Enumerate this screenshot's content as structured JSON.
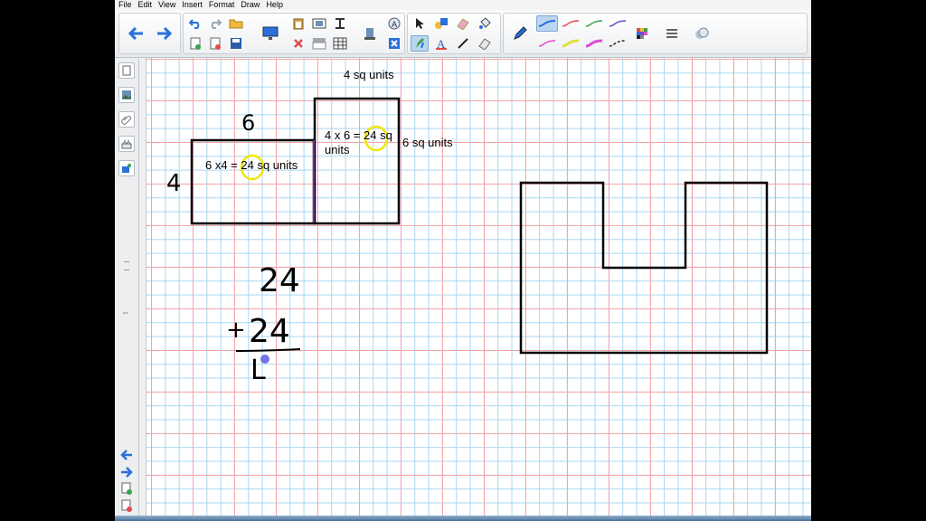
{
  "menu": [
    "File",
    "Edit",
    "View",
    "Insert",
    "Format",
    "Draw",
    "Help"
  ],
  "toolbar_icons": [
    "back-arrow-icon",
    "forward-arrow-icon",
    "undo-icon",
    "redo-icon",
    "open-file-icon",
    "save-icon",
    "screen-shade-icon",
    "delete-icon",
    "insert-table-icon",
    "pen-tool-icon",
    "select-arrow-icon",
    "fill-icon",
    "eraser-icon",
    "line-icon",
    "text-icon",
    "pen-color-icon",
    "color-palette-icon",
    "properties-icon"
  ],
  "pen_colors": [
    "#2a6fdb",
    "#e24b4b",
    "#3aa34a",
    "#6a4fc8",
    "#e0e03a",
    "#e04bd0"
  ],
  "side_icons": [
    "page-sorter-icon",
    "gallery-icon",
    "attachments-icon",
    "properties-icon",
    "addons-icon"
  ],
  "labels": {
    "top_area": "4 sq units",
    "left_rect_calc": "6 x4 = 24 sq units",
    "right_rect_calc_line1": "4 x 6 = 24 sq",
    "right_rect_calc_line2": "units",
    "side_area": "6 sq units"
  },
  "handwriting": {
    "dim_top": "6",
    "dim_left": "4",
    "sum_top": "24",
    "sum_plus": "+",
    "sum_bottom": "24",
    "sum_partial": "L"
  },
  "colors": {
    "highlight_circle": "#f2e600",
    "divider": "#7b2a9a",
    "accent_blue": "#2a6fdb"
  }
}
